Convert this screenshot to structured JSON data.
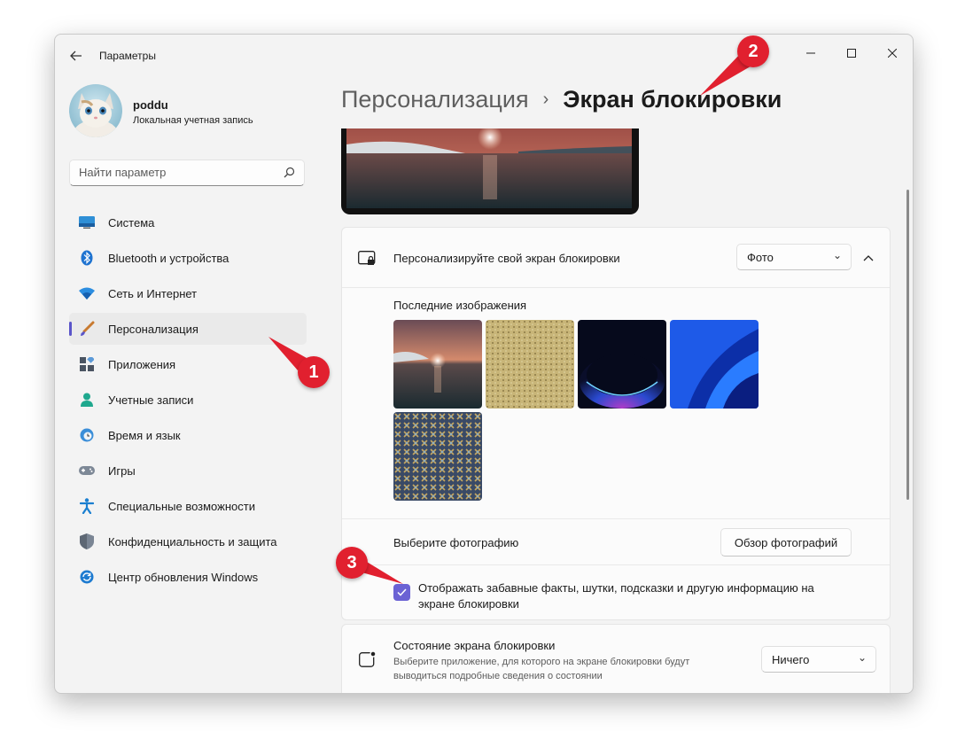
{
  "window": {
    "title": "Параметры"
  },
  "profile": {
    "name": "poddu",
    "account_type": "Локальная учетная запись"
  },
  "search": {
    "placeholder": "Найти параметр"
  },
  "sidebar": {
    "items": [
      {
        "label": "Система",
        "icon": "system-icon"
      },
      {
        "label": "Bluetooth и устройства",
        "icon": "bluetooth-icon"
      },
      {
        "label": "Сеть и Интернет",
        "icon": "wifi-icon"
      },
      {
        "label": "Персонализация",
        "icon": "brush-icon",
        "active": true
      },
      {
        "label": "Приложения",
        "icon": "apps-icon"
      },
      {
        "label": "Учетные записи",
        "icon": "person-icon"
      },
      {
        "label": "Время и язык",
        "icon": "clock-globe-icon"
      },
      {
        "label": "Игры",
        "icon": "gamepad-icon"
      },
      {
        "label": "Специальные возможности",
        "icon": "accessibility-icon"
      },
      {
        "label": "Конфиденциальность и защита",
        "icon": "shield-icon"
      },
      {
        "label": "Центр обновления Windows",
        "icon": "update-icon"
      }
    ]
  },
  "breadcrumb": {
    "parent": "Персонализация",
    "separator": "›",
    "current": "Экран блокировки"
  },
  "lockscreen": {
    "personalize_label": "Персонализируйте свой экран блокировки",
    "personalize_value": "Фото",
    "recent_images_label": "Последние изображения",
    "choose_photo_label": "Выберите фотографию",
    "browse_button": "Обзор фотографий",
    "fun_facts_checkbox": {
      "checked": true,
      "line1": "Отображать забавные факты, шутки, подсказки и другую информацию на",
      "line2": "экране блокировки"
    },
    "status_title": "Состояние экрана блокировки",
    "status_desc_line1": "Выберите приложение, для которого на экране блокировки будут",
    "status_desc_line2": "выводиться подробные сведения о состоянии",
    "status_value": "Ничего"
  },
  "annotations": [
    "1",
    "2",
    "3"
  ],
  "colors": {
    "accent": "#5a55c9",
    "checkbox": "#6b62d4",
    "marker": "#e1202f"
  }
}
